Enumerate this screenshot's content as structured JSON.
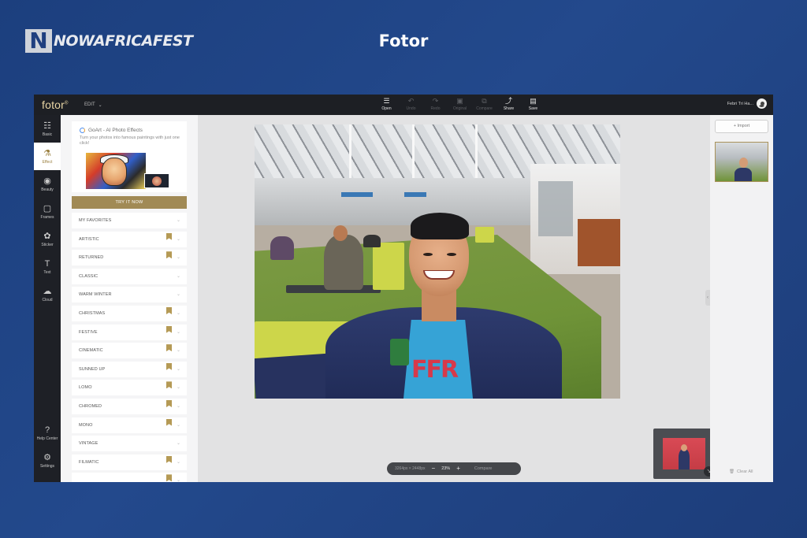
{
  "brand": {
    "mark": "N",
    "name": "NOWAFRICAFEST"
  },
  "page_title": "Fotor",
  "app": {
    "logo": "fotor",
    "edit_menu": "EDIT",
    "toolbar": [
      {
        "label": "Open",
        "icon": "menu-icon",
        "enabled": true
      },
      {
        "label": "Undo",
        "icon": "undo-icon",
        "enabled": false
      },
      {
        "label": "Redo",
        "icon": "redo-icon",
        "enabled": false
      },
      {
        "label": "Original",
        "icon": "original-icon",
        "enabled": false
      },
      {
        "label": "Compare",
        "icon": "compare-icon",
        "enabled": false
      },
      {
        "label": "Share",
        "icon": "share-icon",
        "enabled": true
      },
      {
        "label": "Save",
        "icon": "save-icon",
        "enabled": true
      }
    ],
    "user_name": "Febri Tri Ha...",
    "rail": [
      {
        "label": "Basic",
        "icon": "sliders-icon"
      },
      {
        "label": "Effect",
        "icon": "flask-icon",
        "active": true
      },
      {
        "label": "Beauty",
        "icon": "eye-icon"
      },
      {
        "label": "Frames",
        "icon": "frame-icon"
      },
      {
        "label": "Sticker",
        "icon": "sticker-icon"
      },
      {
        "label": "Text",
        "icon": "text-icon"
      },
      {
        "label": "Cloud",
        "icon": "cloud-icon"
      }
    ],
    "rail_bottom": [
      {
        "label": "Help Center",
        "icon": "help-icon"
      },
      {
        "label": "Settings",
        "icon": "settings-icon"
      }
    ],
    "promo": {
      "title": "GoArt - AI Photo Effects",
      "description": "Turn your photos into famous paintings with just one click!",
      "button": "TRY IT NOW"
    },
    "categories": [
      {
        "name": "MY FAVORITES",
        "premium": false
      },
      {
        "name": "ARTISTIC",
        "premium": true
      },
      {
        "name": "RETURNED",
        "premium": true
      },
      {
        "name": "CLASSIC",
        "premium": false
      },
      {
        "name": "WARM WINTER",
        "premium": false
      },
      {
        "name": "CHRISTMAS",
        "premium": true
      },
      {
        "name": "FESTIVE",
        "premium": true
      },
      {
        "name": "CINEMATIC",
        "premium": true
      },
      {
        "name": "SUNNED UP",
        "premium": true
      },
      {
        "name": "LOMO",
        "premium": true
      },
      {
        "name": "CHROMED",
        "premium": true
      },
      {
        "name": "MONO",
        "premium": true
      },
      {
        "name": "VINTAGE",
        "premium": false
      },
      {
        "name": "FILMATIC",
        "premium": true
      },
      {
        "name": "",
        "premium": true
      }
    ],
    "zoom": {
      "dimensions": "3264px × 2448px",
      "value": "23%",
      "minus": "−",
      "plus": "+",
      "compare": "Compare"
    },
    "right_panel": {
      "import": "+ Import",
      "clear_all": "Clear All"
    },
    "colors": {
      "accent": "#a18a55",
      "topbar": "#1d1f24",
      "background": "#23498c"
    }
  }
}
